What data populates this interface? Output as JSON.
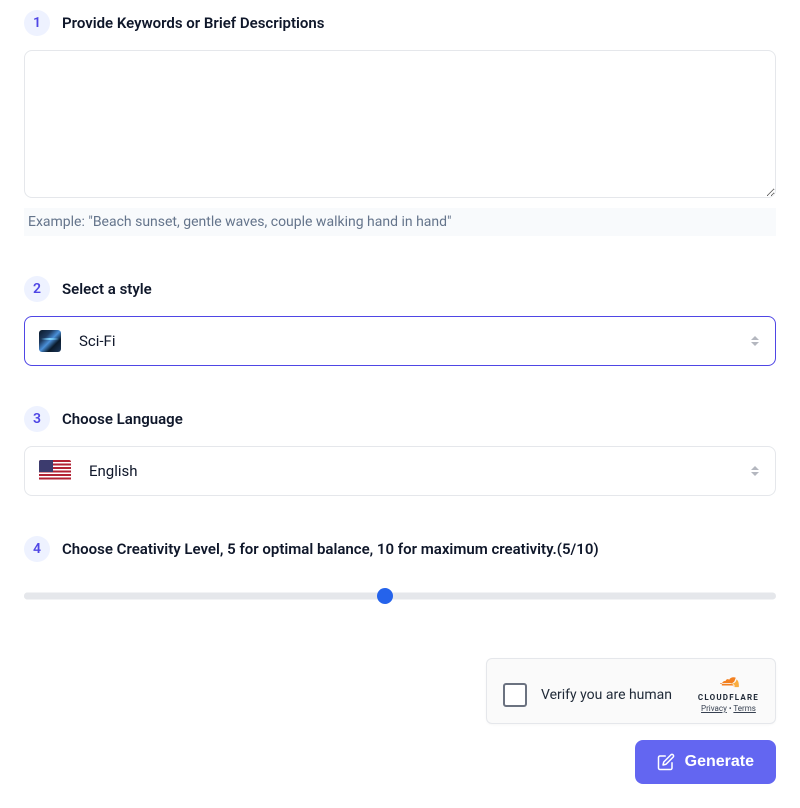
{
  "step1": {
    "number": "1",
    "label": "Provide Keywords or Brief Descriptions",
    "textarea_value": "",
    "example": "Example:  \"Beach sunset, gentle waves, couple walking hand in hand\""
  },
  "step2": {
    "number": "2",
    "label": "Select a style",
    "selected": "Sci-Fi"
  },
  "step3": {
    "number": "3",
    "label": "Choose Language",
    "selected": "English"
  },
  "step4": {
    "number": "4",
    "label": "Choose Creativity Level, 5 for optimal balance, 10 for maximum creativity.(5/10)",
    "value": 5,
    "max": 10
  },
  "captcha": {
    "label": "Verify you are human",
    "brand": "CLOUDFLARE",
    "privacy": "Privacy",
    "terms": "Terms"
  },
  "generate_label": "Generate"
}
